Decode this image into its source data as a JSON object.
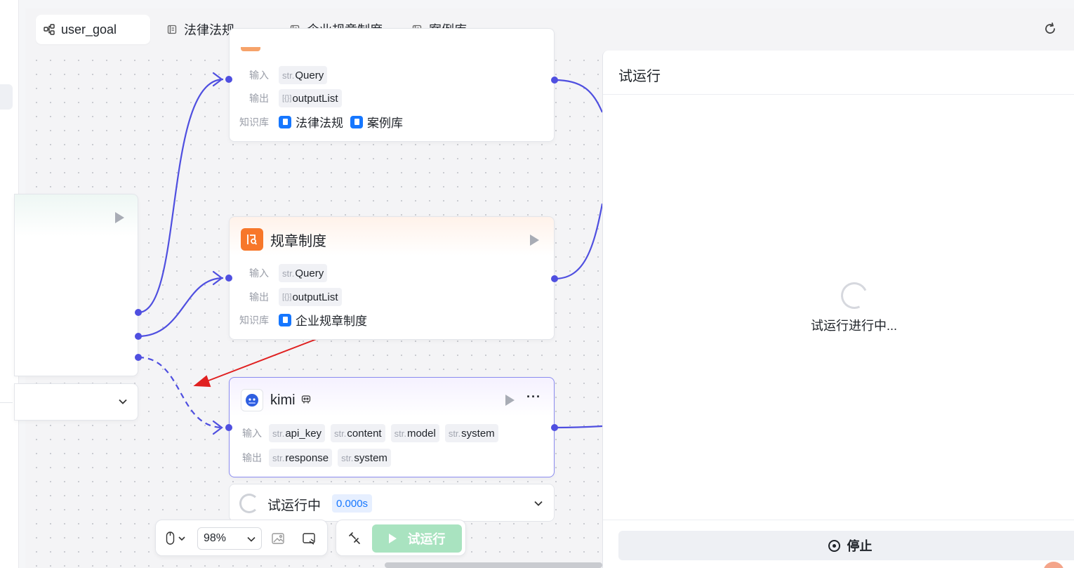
{
  "tabs": [
    {
      "label": "user_goal",
      "icon": "workflow-icon",
      "active": true
    },
    {
      "label": "法律法规",
      "icon": "document-icon"
    },
    {
      "label": "企业规章制度",
      "icon": "document-icon"
    },
    {
      "label": "案例库",
      "icon": "document-icon"
    }
  ],
  "labels": {
    "input": "输入",
    "output": "输出",
    "knowledge": "知识库"
  },
  "node_top": {
    "inputs": [
      {
        "type": "str.",
        "name": "Query"
      }
    ],
    "outputs": [
      {
        "type": "[{}]",
        "name": "outputList"
      }
    ],
    "knowledge": [
      "法律法规",
      "案例库"
    ]
  },
  "node_rules": {
    "title": "规章制度",
    "inputs": [
      {
        "type": "str.",
        "name": "Query"
      }
    ],
    "outputs": [
      {
        "type": "[{}]",
        "name": "outputList"
      }
    ],
    "knowledge": [
      "企业规章制度"
    ]
  },
  "node_kimi": {
    "title": "kimi",
    "more": "···",
    "inputs": [
      {
        "type": "str.",
        "name": "api_key"
      },
      {
        "type": "str.",
        "name": "content"
      },
      {
        "type": "str.",
        "name": "model"
      },
      {
        "type": "str.",
        "name": "system"
      }
    ],
    "outputs": [
      {
        "type": "str.",
        "name": "response"
      },
      {
        "type": "str.",
        "name": "system"
      }
    ]
  },
  "status": {
    "label": "试运行中",
    "time": "0.000s"
  },
  "toolbar": {
    "zoom": "98%",
    "run_label": "试运行"
  },
  "panel": {
    "title": "试运行",
    "running": "试运行进行中...",
    "stop_label": "停止"
  },
  "colors": {
    "edge": "#4f4fe0",
    "run_button": "#a9e3c0",
    "arrow": "#e02020"
  }
}
